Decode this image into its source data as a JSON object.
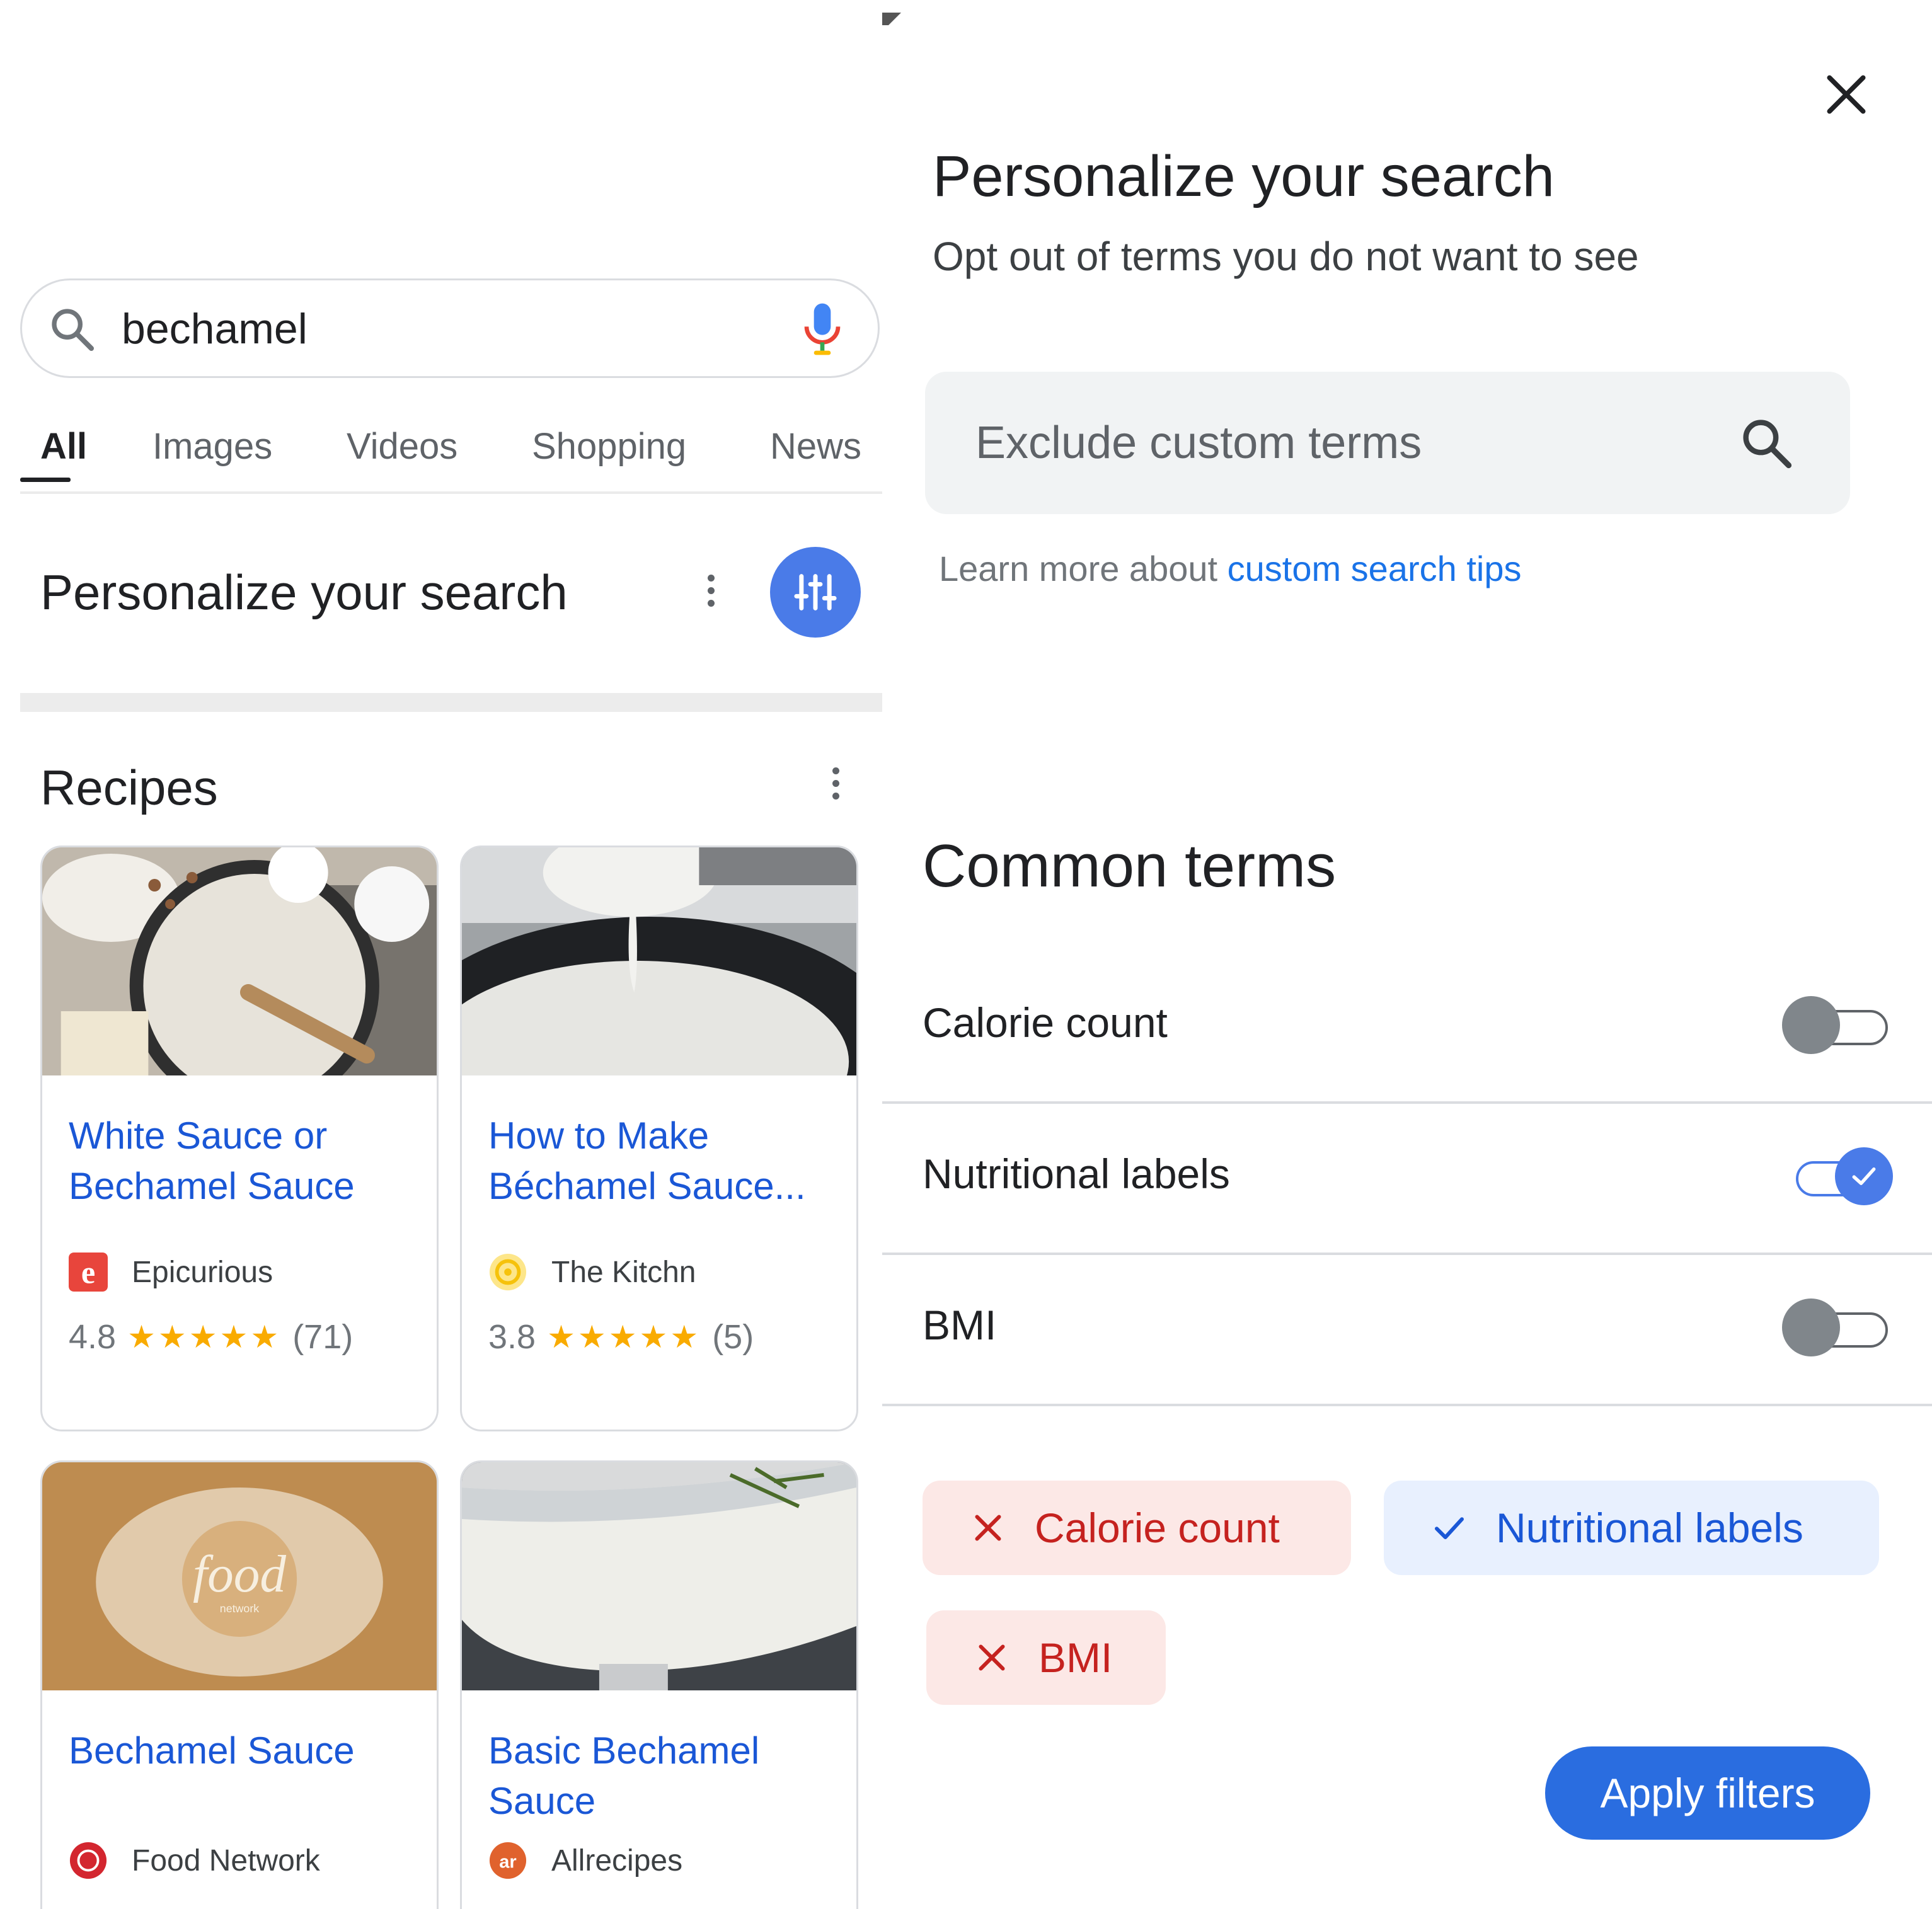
{
  "left": {
    "search": {
      "query": "bechamel"
    },
    "tabs": [
      {
        "label": "All",
        "active": true
      },
      {
        "label": "Images"
      },
      {
        "label": "Videos"
      },
      {
        "label": "Shopping"
      },
      {
        "label": "News"
      }
    ],
    "personalize": {
      "title": "Personalize your search",
      "icon": "tune-icon"
    },
    "recipes": {
      "title": "Recipes",
      "cards": [
        {
          "title": "White Sauce or Bechamel Sauce",
          "source": "Epicurious",
          "rating": "4.8",
          "stars": "★★★★★",
          "reviews": "(71)"
        },
        {
          "title": "How to Make Béchamel Sauce...",
          "source": "The Kitchn",
          "rating": "3.8",
          "stars": "★★★★★",
          "reviews": "(5)"
        },
        {
          "title": "Bechamel Sauce",
          "source": "Food Network"
        },
        {
          "title": "Basic Bechamel Sauce",
          "source": "Allrecipes"
        }
      ],
      "image_text": {
        "food_logo": "food",
        "food_logo_sub": "network"
      }
    }
  },
  "right": {
    "title": "Personalize your search",
    "subtitle": "Opt out of terms you do not want to see",
    "exclude": {
      "placeholder": "Exclude custom terms"
    },
    "learn": {
      "prefix": "Learn more about ",
      "link": "custom search tips"
    },
    "common_title": "Common terms",
    "terms": [
      {
        "label": "Calorie count",
        "on": false
      },
      {
        "label": "Nutritional labels",
        "on": true
      },
      {
        "label": "BMI",
        "on": false
      }
    ],
    "chips": [
      {
        "label": "Calorie count",
        "state": "excluded",
        "icon": "close-icon"
      },
      {
        "label": "Nutritional labels",
        "state": "included",
        "icon": "check-icon"
      },
      {
        "label": "BMI",
        "state": "excluded",
        "icon": "close-icon"
      }
    ],
    "apply_label": "Apply filters"
  },
  "colors": {
    "accent": "#4a7be8",
    "link": "#1a57d6",
    "exclude_red": "#c5221f",
    "exclude_bg": "#fce8e6",
    "include_bg": "#e8f0fe",
    "star": "#f9ab00"
  }
}
